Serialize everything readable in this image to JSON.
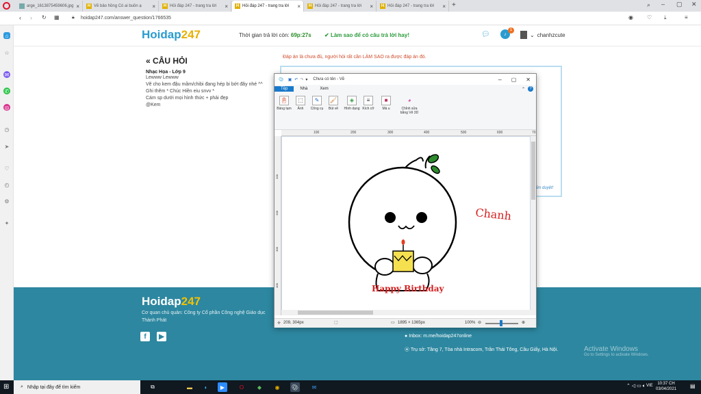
{
  "browser": {
    "tabs": [
      {
        "title": "arge_1613875459606.jpg"
      },
      {
        "title": "Vẽ bảo hồng Có ai buồn ạ"
      },
      {
        "title": "Hỏi đáp 247 - trang tra lời"
      },
      {
        "title": "Hỏi đáp 247 - trang tra lời"
      },
      {
        "title": "Hỏi đáp 247 - trang tra lời"
      },
      {
        "title": "Hỏi đáp 247 - trang tra lời"
      }
    ],
    "url": "hoidap247.com/answer_question/1766535"
  },
  "header": {
    "logo_main": "Hoidap",
    "logo_num": "247",
    "timer_label": "Thời gian trả lời còn:",
    "timer_value": "69p:27s",
    "howto": "Làm sao để có câu trả lời hay!",
    "notification_count": "1",
    "username": "chanhzcute"
  },
  "question": {
    "heading": "CÂU HỎI",
    "subject": "Nhạc Họa - Lớp 9",
    "lines": [
      "Lewww Lewww",
      "Vẽ cho kem đậu mầm/chibi đang hép bi bớt đây nhé ^^",
      "Ghi thêm * Chúc Hiền eiu snvv *",
      "Cám sp dưới mọi hình thức + phải đẹp",
      "@Kem"
    ]
  },
  "answer": {
    "notice": "Đáp án là chưa đủ, người hỏi rất cần LÀM SAO ra được đáp án đó.",
    "approved_hint": "ấm duyệt!"
  },
  "paint": {
    "title": "Chưa có tên - Vẽ",
    "menu": [
      "Tệp",
      "Nhà",
      "Xem"
    ],
    "ribbon": [
      {
        "label": "Bảng tạm",
        "icon": "clipboard-icon"
      },
      {
        "label": "Ảnh",
        "icon": "image-icon"
      },
      {
        "label": "Công cụ",
        "icon": "tools-icon"
      },
      {
        "label": "Bút vẽ",
        "icon": "brush-icon"
      },
      {
        "label": "Hình dạng",
        "icon": "shapes-icon"
      },
      {
        "label": "Kích cỡ",
        "icon": "size-icon"
      },
      {
        "label": "Mà u",
        "icon": "colors-icon"
      },
      {
        "label": "Chỉnh sửa bằng Vẽ 3D",
        "icon": "paint3d-icon"
      }
    ],
    "ruler_ticks": [
      "100",
      "200",
      "300",
      "400",
      "500",
      "600",
      "70"
    ],
    "vruler_ticks": [
      "100",
      "200",
      "300",
      "400"
    ],
    "canvas_text": {
      "name": "Chanh",
      "greeting": "Happy Birthday"
    },
    "status": {
      "cursor": "209, 304px",
      "size": "1895 × 1365px",
      "zoom": "100%"
    }
  },
  "footer": {
    "logo_main": "Hoidap",
    "logo_num": "247",
    "company": "Cơ quan chủ quản: Công ty Cổ phần Công nghệ Giáo dục Thành Phát",
    "inbox": "Inbox: m.me/hoidap247online",
    "address": "Trụ sở: Tầng 7, Tòa nhà Intracom, Trần Thái Tông, Cầu Giấy, Hà Nội.",
    "activate_title": "Activate Windows",
    "activate_sub": "Go to Settings to activate Windows."
  },
  "taskbar": {
    "search_placeholder": "Nhập tại đây để tìm kiếm",
    "lang": "VIE",
    "time": "10:37 CH",
    "date": "03/04/2021"
  }
}
